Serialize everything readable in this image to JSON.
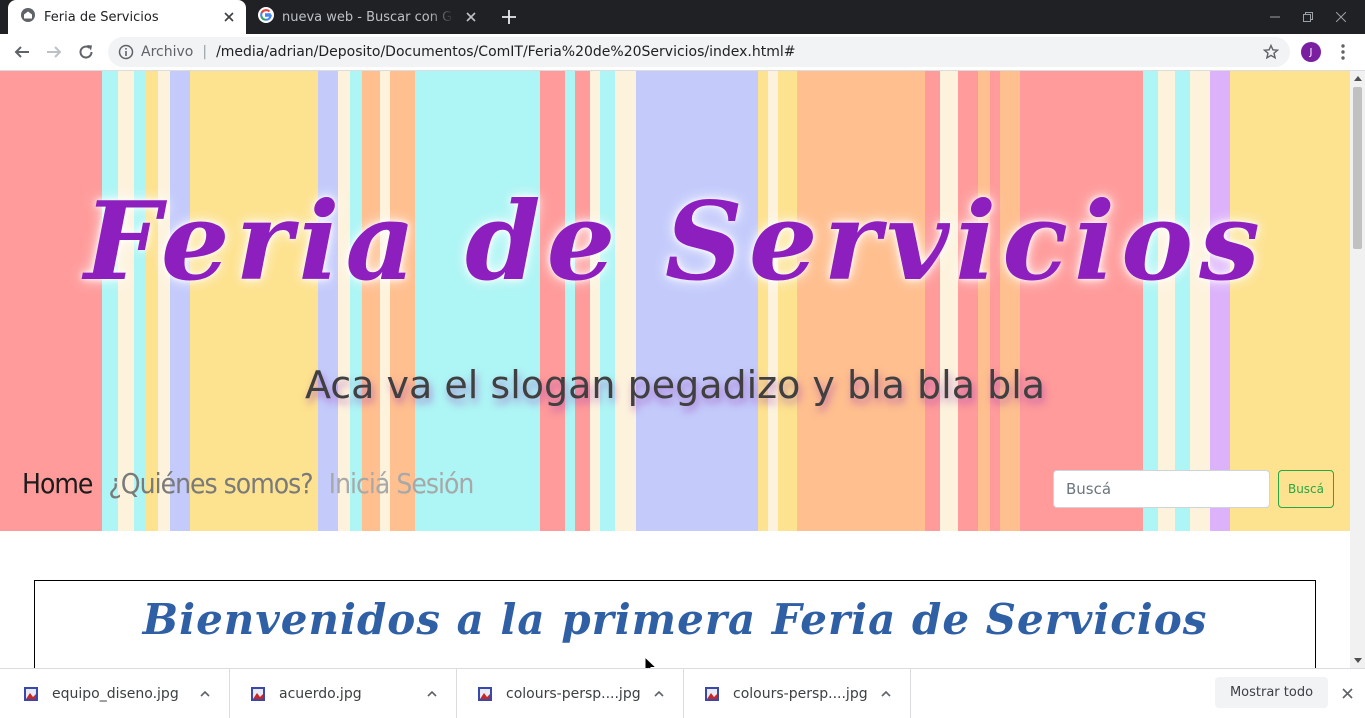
{
  "browser": {
    "tabs": [
      {
        "title": "Feria de Servicios",
        "icon": "page-icon",
        "active": true
      },
      {
        "title": "nueva web - Buscar con Google",
        "icon": "google-icon",
        "active": false
      }
    ],
    "omnibox": {
      "scheme_label": "Archivo",
      "separator": "|",
      "url": "/media/adrian/Deposito/Documentos/ComIT/Feria%20de%20Servicios/index.html#"
    },
    "profile_initial": "J"
  },
  "page": {
    "site_title": "Feria de Servicios",
    "slogan": "Aca va el slogan pegadizo y bla bla bla",
    "nav": {
      "home": "Home",
      "about": "¿Quiénes somos?",
      "login": "Iniciá Sesión"
    },
    "search": {
      "placeholder": "Buscá",
      "button_label": "Buscá"
    },
    "welcome_title": "Bienvenidos a la primera Feria de Servicios",
    "colors": {
      "title": "#8e1fbf",
      "welcome": "#2f5fa5",
      "search_button": "#28a745"
    }
  },
  "downloads": {
    "items": [
      {
        "name": "equipo_diseno.jpg"
      },
      {
        "name": "acuerdo.jpg"
      },
      {
        "name": "colours-persp....jpg"
      },
      {
        "name": "colours-persp....jpg"
      }
    ],
    "show_all_label": "Mostrar todo"
  }
}
